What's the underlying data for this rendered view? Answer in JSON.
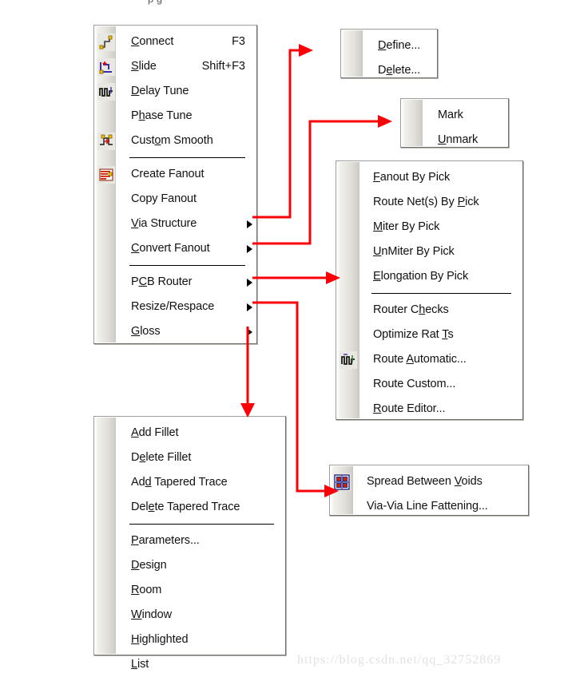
{
  "page": {
    "watermark": "https://blog.csdn.net/qq_32752869",
    "top_fragment": "p g"
  },
  "colors": {
    "arrow": "#fb0007",
    "menu_border": "#9d9d9d",
    "menu_bg": "#ffffff",
    "gutter_light": "#f2f1ec",
    "gutter_dark": "#c9c8c1",
    "text": "#111111",
    "separator": "#000000"
  },
  "menus": {
    "route": {
      "name": "Route menu",
      "items": [
        {
          "label": "Connect",
          "pre": "",
          "mnemonic": "C",
          "post": "onnect",
          "accel": "F3",
          "icon": "connect-icon",
          "submenu": false
        },
        {
          "label": "Slide",
          "pre": "",
          "mnemonic": "S",
          "post": "lide",
          "accel": "Shift+F3",
          "icon": "slide-icon",
          "submenu": false
        },
        {
          "label": "Delay Tune",
          "pre": "",
          "mnemonic": "D",
          "post": "elay Tune",
          "accel": "",
          "icon": "delay-tune-icon",
          "submenu": false
        },
        {
          "label": "Phase Tune",
          "pre": "P",
          "mnemonic": "h",
          "post": "ase Tune",
          "accel": "",
          "icon": "",
          "submenu": false
        },
        {
          "label": "Custom Smooth",
          "pre": "Cust",
          "mnemonic": "o",
          "post": "m Smooth",
          "accel": "",
          "icon": "custom-smooth-icon",
          "submenu": false
        },
        {
          "separator": true
        },
        {
          "label": "Create Fanout",
          "pre": "",
          "mnemonic": "",
          "post": "Create Fanout",
          "accel": "",
          "icon": "create-fanout-icon",
          "submenu": false
        },
        {
          "label": "Copy Fanout",
          "pre": "",
          "mnemonic": "",
          "post": "Copy Fanout",
          "accel": "",
          "icon": "",
          "submenu": false
        },
        {
          "label": "Via Structure",
          "pre": "",
          "mnemonic": "V",
          "post": "ia Structure",
          "accel": "",
          "icon": "",
          "submenu": true
        },
        {
          "label": "Convert Fanout",
          "pre": "",
          "mnemonic": "C",
          "post": "onvert Fanout",
          "accel": "",
          "icon": "",
          "submenu": true
        },
        {
          "separator": true
        },
        {
          "label": "PCB Router",
          "pre": "P",
          "mnemonic": "C",
          "post": "B Router",
          "accel": "",
          "icon": "",
          "submenu": true
        },
        {
          "label": "Resize/Respace",
          "pre": "",
          "mnemonic": "",
          "post": "Resize/Respace",
          "accel": "",
          "icon": "",
          "submenu": true
        },
        {
          "label": "Gloss",
          "pre": "",
          "mnemonic": "G",
          "post": "loss",
          "accel": "",
          "icon": "",
          "submenu": true
        }
      ]
    },
    "via_structure": {
      "name": "Via Structure submenu",
      "items": [
        {
          "label": "Define...",
          "pre": "",
          "mnemonic": "D",
          "post": "efine...",
          "accel": "",
          "icon": "",
          "submenu": false
        },
        {
          "label": "Delete...",
          "pre": "D",
          "mnemonic": "e",
          "post": "lete...",
          "accel": "",
          "icon": "",
          "submenu": false
        }
      ]
    },
    "convert_fanout": {
      "name": "Convert Fanout submenu",
      "items": [
        {
          "label": "Mark",
          "pre": "",
          "mnemonic": "",
          "post": "Mark",
          "accel": "",
          "icon": "",
          "submenu": false
        },
        {
          "label": "Unmark",
          "pre": "",
          "mnemonic": "U",
          "post": "nmark",
          "accel": "",
          "icon": "",
          "submenu": false
        }
      ]
    },
    "pcb_router": {
      "name": "PCB Router submenu",
      "items": [
        {
          "label": "Fanout By Pick",
          "pre": "",
          "mnemonic": "F",
          "post": "anout By Pick",
          "accel": "",
          "icon": "",
          "submenu": false
        },
        {
          "label": "Route Net(s) By Pick",
          "pre": "Route Net(s) By ",
          "mnemonic": "P",
          "post": "ick",
          "accel": "",
          "icon": "",
          "submenu": false
        },
        {
          "label": "Miter By Pick",
          "pre": "",
          "mnemonic": "M",
          "post": "iter By Pick",
          "accel": "",
          "icon": "",
          "submenu": false
        },
        {
          "label": "UnMiter By Pick",
          "pre": "",
          "mnemonic": "U",
          "post": "nMiter By Pick",
          "accel": "",
          "icon": "",
          "submenu": false
        },
        {
          "label": "Elongation By Pick",
          "pre": "",
          "mnemonic": "E",
          "post": "longation By Pick",
          "accel": "",
          "icon": "",
          "submenu": false
        },
        {
          "separator": true
        },
        {
          "label": "Router Checks",
          "pre": "Router C",
          "mnemonic": "h",
          "post": "ecks",
          "accel": "",
          "icon": "",
          "submenu": false
        },
        {
          "label": "Optimize Rat Ts",
          "pre": "Optimize Rat ",
          "mnemonic": "T",
          "post": "s",
          "accel": "",
          "icon": "",
          "submenu": false
        },
        {
          "label": "Route Automatic...",
          "pre": "Route ",
          "mnemonic": "A",
          "post": "utomatic...",
          "accel": "",
          "icon": "route-automatic-icon",
          "submenu": false
        },
        {
          "label": "Route Custom...",
          "pre": "",
          "mnemonic": "",
          "post": "Route Custom...",
          "accel": "",
          "icon": "",
          "submenu": false
        },
        {
          "label": "Route Editor...",
          "pre": "",
          "mnemonic": "R",
          "post": "oute Editor...",
          "accel": "",
          "icon": "",
          "submenu": false
        }
      ]
    },
    "gloss": {
      "name": "Gloss submenu",
      "items": [
        {
          "label": "Add Fillet",
          "pre": "",
          "mnemonic": "A",
          "post": "dd Fillet",
          "accel": "",
          "icon": "",
          "submenu": false
        },
        {
          "label": "Delete Fillet",
          "pre": "D",
          "mnemonic": "e",
          "post": "lete Fillet",
          "accel": "",
          "icon": "",
          "submenu": false
        },
        {
          "label": "Add Tapered Trace",
          "pre": "Ad",
          "mnemonic": "d",
          "post": " Tapered Trace",
          "accel": "",
          "icon": "",
          "submenu": false
        },
        {
          "label": "Delete Tapered Trace",
          "pre": "Del",
          "mnemonic": "e",
          "post": "te Tapered Trace",
          "accel": "",
          "icon": "",
          "submenu": false
        },
        {
          "separator": true
        },
        {
          "label": "Parameters...",
          "pre": "",
          "mnemonic": "P",
          "post": "arameters...",
          "accel": "",
          "icon": "",
          "submenu": false
        },
        {
          "label": "Design",
          "pre": "",
          "mnemonic": "D",
          "post": "esign",
          "accel": "",
          "icon": "",
          "submenu": false
        },
        {
          "label": "Room",
          "pre": "",
          "mnemonic": "R",
          "post": "oom",
          "accel": "",
          "icon": "",
          "submenu": false
        },
        {
          "label": "Window",
          "pre": "",
          "mnemonic": "W",
          "post": "indow",
          "accel": "",
          "icon": "",
          "submenu": false
        },
        {
          "label": "Highlighted",
          "pre": "",
          "mnemonic": "H",
          "post": "ighlighted",
          "accel": "",
          "icon": "",
          "submenu": false
        },
        {
          "label": "List",
          "pre": "",
          "mnemonic": "L",
          "post": "ist",
          "accel": "",
          "icon": "",
          "submenu": false
        }
      ]
    },
    "resize_respace": {
      "name": "Resize/Respace submenu",
      "items": [
        {
          "label": "Spread Between Voids",
          "pre": "Spread Between ",
          "mnemonic": "V",
          "post": "oids",
          "accel": "",
          "icon": "spread-between-voids-icon",
          "submenu": false
        },
        {
          "label": "Via-Via Line Fattening...",
          "pre": "Via-Via Line Fattening",
          "mnemonic": "",
          "post": "...",
          "accel": "",
          "icon": "",
          "submenu": false
        }
      ]
    }
  }
}
